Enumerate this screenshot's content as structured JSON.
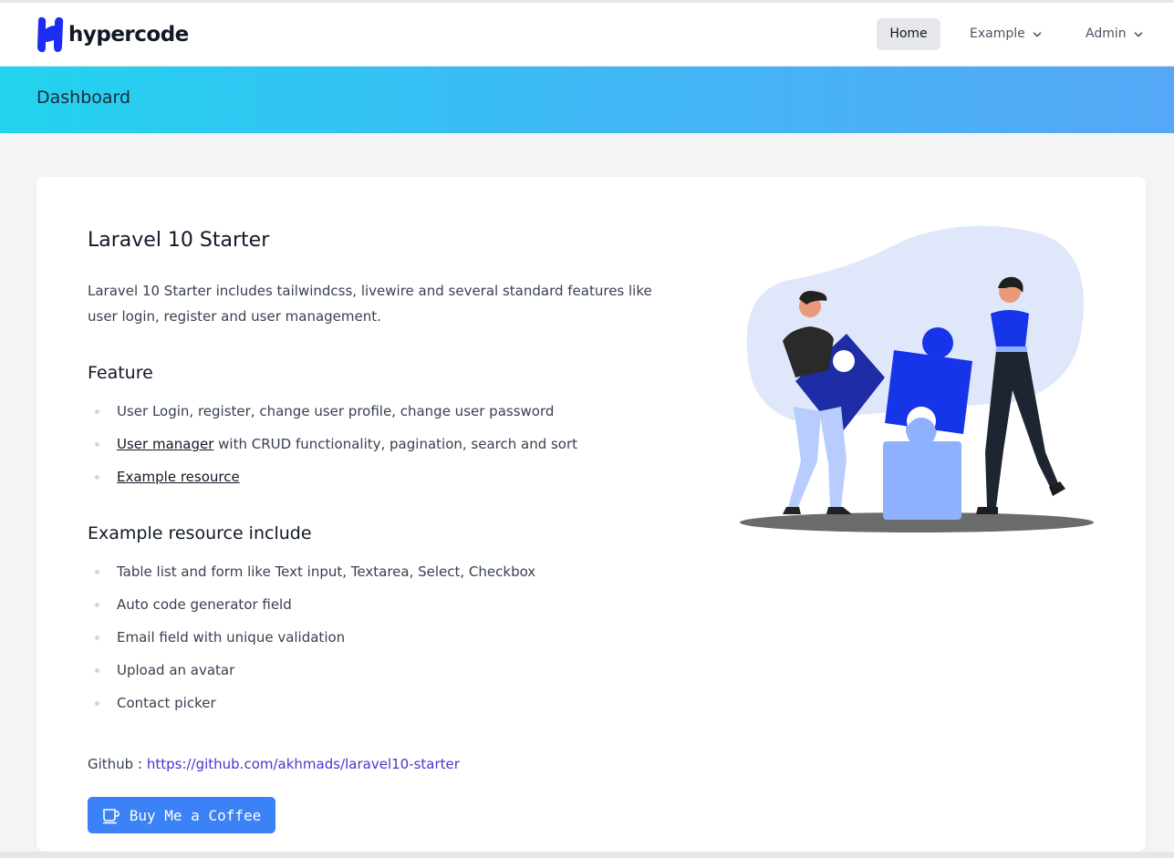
{
  "brand": {
    "name": "hypercode",
    "color": "#1d2cf3"
  },
  "nav": {
    "home": "Home",
    "example": "Example",
    "admin": "Admin"
  },
  "header": {
    "title": "Dashboard"
  },
  "content": {
    "title": "Laravel 10 Starter",
    "intro": "Laravel 10 Starter includes tailwindcss, livewire and several standard features like user login, register and user management.",
    "feature_heading": "Feature",
    "features": {
      "f1": "User Login, register, change user profile, change user password",
      "f2_link": "User manager",
      "f2_rest": " with CRUD functionality, pagination, search and sort",
      "f3_link": "Example resource"
    },
    "resource_heading": "Example resource include",
    "resources": [
      "Table list and form like Text input, Textarea, Select, Checkbox",
      "Auto code generator field",
      "Email field with unique validation",
      "Upload an avatar",
      "Contact picker"
    ],
    "github_label": "Github : ",
    "github_url": "https://github.com/akhmads/laravel10-starter",
    "coffee_button": "Buy Me a Coffee"
  },
  "colors": {
    "accent": "#3b82f6",
    "link": "#4338ca",
    "header_gradient_start": "#22d3ee",
    "header_gradient_end": "#55a8f7"
  },
  "icons": {
    "logo": "hypercode-logo-icon",
    "dropdown": "chevron-down-icon",
    "coffee": "coffee-cup-icon",
    "illustration": "puzzle-teamwork-illustration"
  }
}
